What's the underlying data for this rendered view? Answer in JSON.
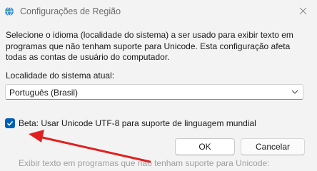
{
  "window": {
    "title": "Configurações de Região"
  },
  "content": {
    "description": "Selecione o idioma (localidade do sistema) a ser usado para exibir texto em programas que não tenham suporte para Unicode. Esta configuração afeta todas as contas de usuário do computador.",
    "locale_label": "Localidade do sistema atual:",
    "locale_value": "Português (Brasil)",
    "utf8_checkbox_label": "Beta: Usar Unicode UTF-8 para suporte de linguagem mundial",
    "utf8_checked": true
  },
  "buttons": {
    "ok": "OK",
    "cancel": "Cancelar"
  },
  "background_partial_text": "Exibir texto em programas que não tenham suporte para Unicode:",
  "annotation": {
    "arrow_color": "#e02020"
  },
  "icons": {
    "app": "globe-icon",
    "close": "close-icon",
    "dropdown": "chevron-down-icon",
    "check": "checkmark-icon"
  }
}
